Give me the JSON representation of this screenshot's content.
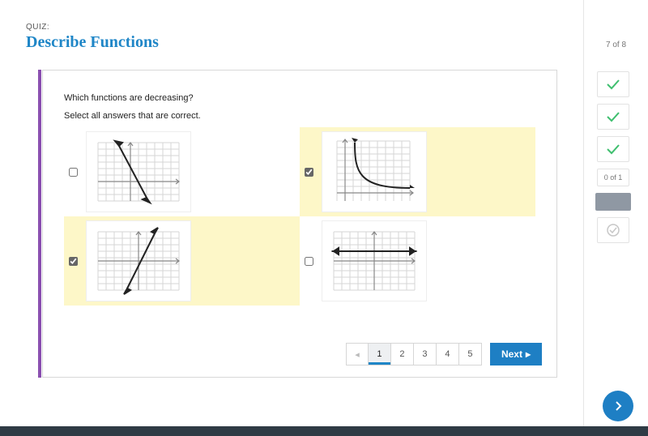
{
  "header": {
    "quiz_label": "QUIZ:",
    "title": "Describe Functions"
  },
  "sidebar": {
    "progress": "7 of 8",
    "status_label": "0 of 1"
  },
  "question": {
    "prompt": "Which functions are decreasing?",
    "help": "Select all answers that are correct.",
    "answers": [
      {
        "selected": false,
        "graph": "line-neg-steep"
      },
      {
        "selected": true,
        "graph": "recip-decay"
      },
      {
        "selected": true,
        "graph": "line-pos"
      },
      {
        "selected": false,
        "graph": "horizontal"
      }
    ]
  },
  "pager": {
    "prev_glyph": "◂",
    "pages": [
      "1",
      "2",
      "3",
      "4",
      "5"
    ],
    "current": "1",
    "next_label": "Next",
    "next_glyph": "▸"
  }
}
